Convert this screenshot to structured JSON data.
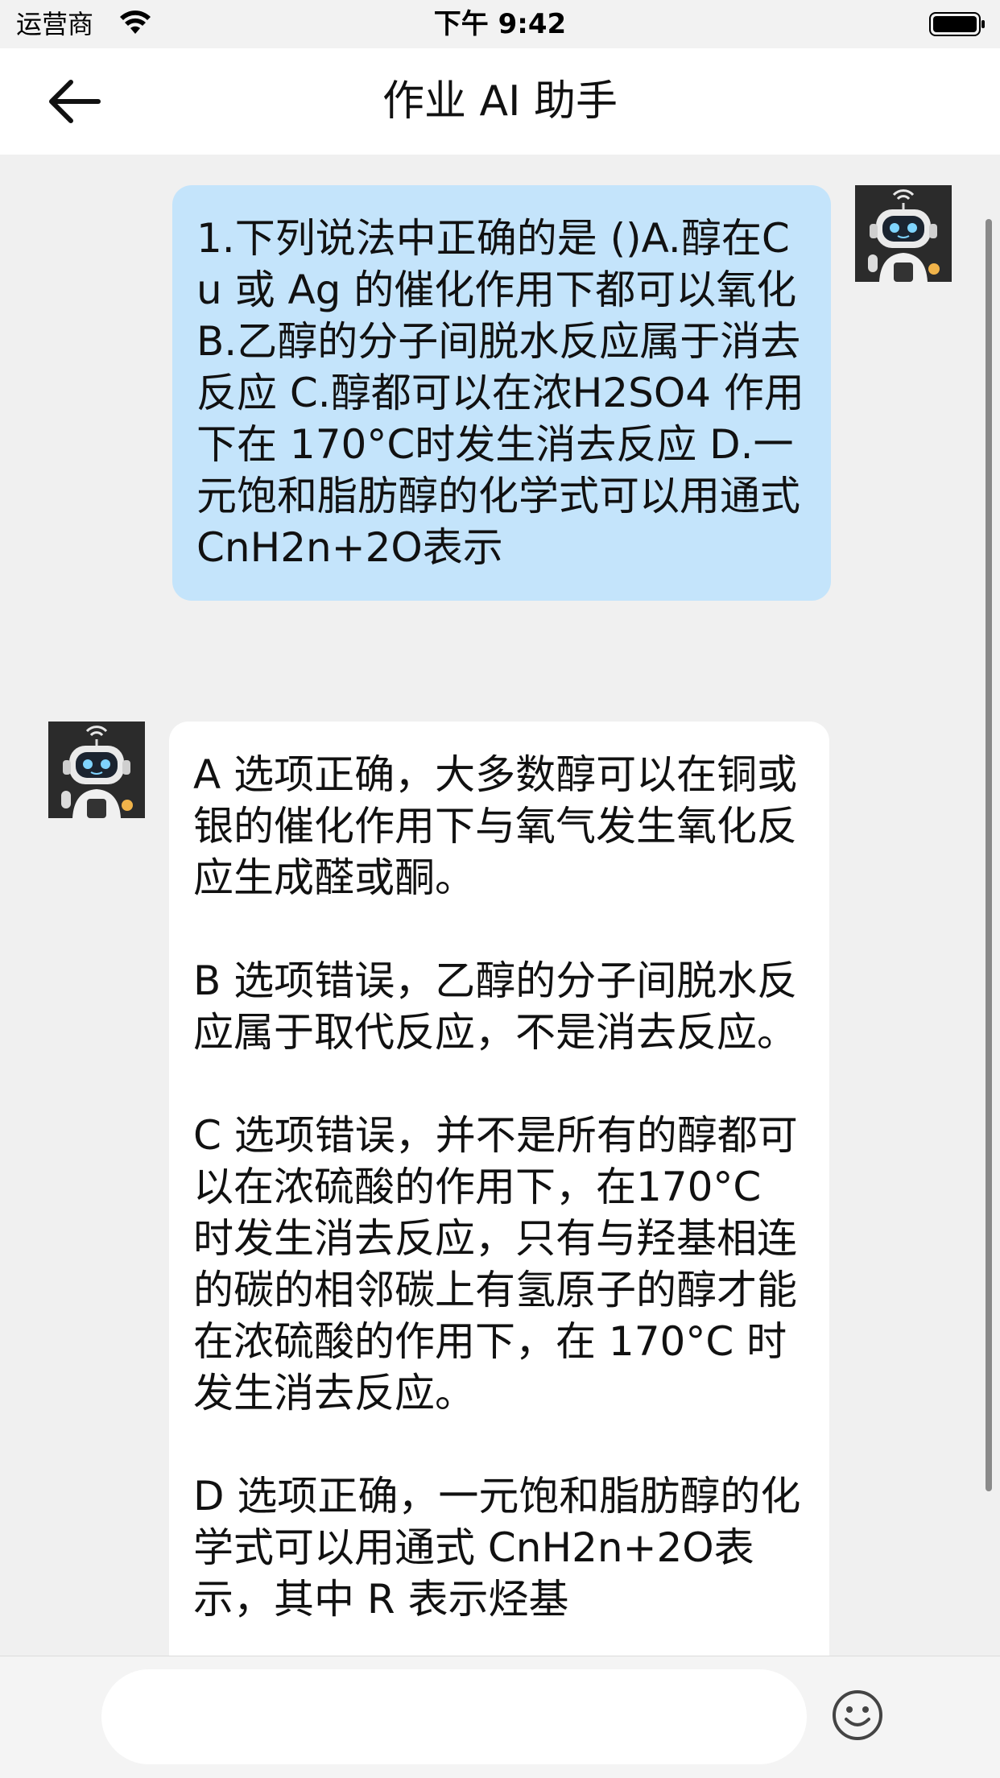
{
  "status_bar": {
    "carrier": "运营商",
    "time": "下午 9:42"
  },
  "nav": {
    "title": "作业 AI 助手"
  },
  "messages": [
    {
      "sender": "user",
      "text": "1.下列说法中正确的是 ()A.醇在Cu 或 Ag 的催化作用下都可以氧化 B.乙醇的分子间脱水反应属于消去反应 C.醇都可以在浓H2SO4 作用下在 170°C时发生消去反应 D.一元饱和脂肪醇的化学式可以用通式 CnH2n+2O表示"
    },
    {
      "sender": "assistant",
      "text": "A 选项正确，大多数醇可以在铜或银的催化作用下与氧气发生氧化反应生成醛或酮。\n\nB 选项错误，乙醇的分子间脱水反应属于取代反应，不是消去反应。\n\nC 选项错误，并不是所有的醇都可以在浓硫酸的作用下，在170°C 时发生消去反应，只有与羟基相连的碳的相邻碳上有氢原子的醇才能在浓硫酸的作用下，在 170°C 时发生消去反应。\n\nD 选项正确，一元饱和脂肪醇的化学式可以用通式 CnH2n+2O表示，其中 R 表示烃基"
    }
  ],
  "input": {
    "value": "",
    "placeholder": ""
  },
  "icons": {
    "back": "arrow-left-icon",
    "emoji": "smiley-icon",
    "wifi": "wifi-icon",
    "battery": "battery-icon",
    "avatar": "robot-avatar"
  },
  "colors": {
    "user_bubble": "#c4e4fb",
    "assistant_bubble": "#ffffff",
    "background": "#f0f0f0"
  }
}
